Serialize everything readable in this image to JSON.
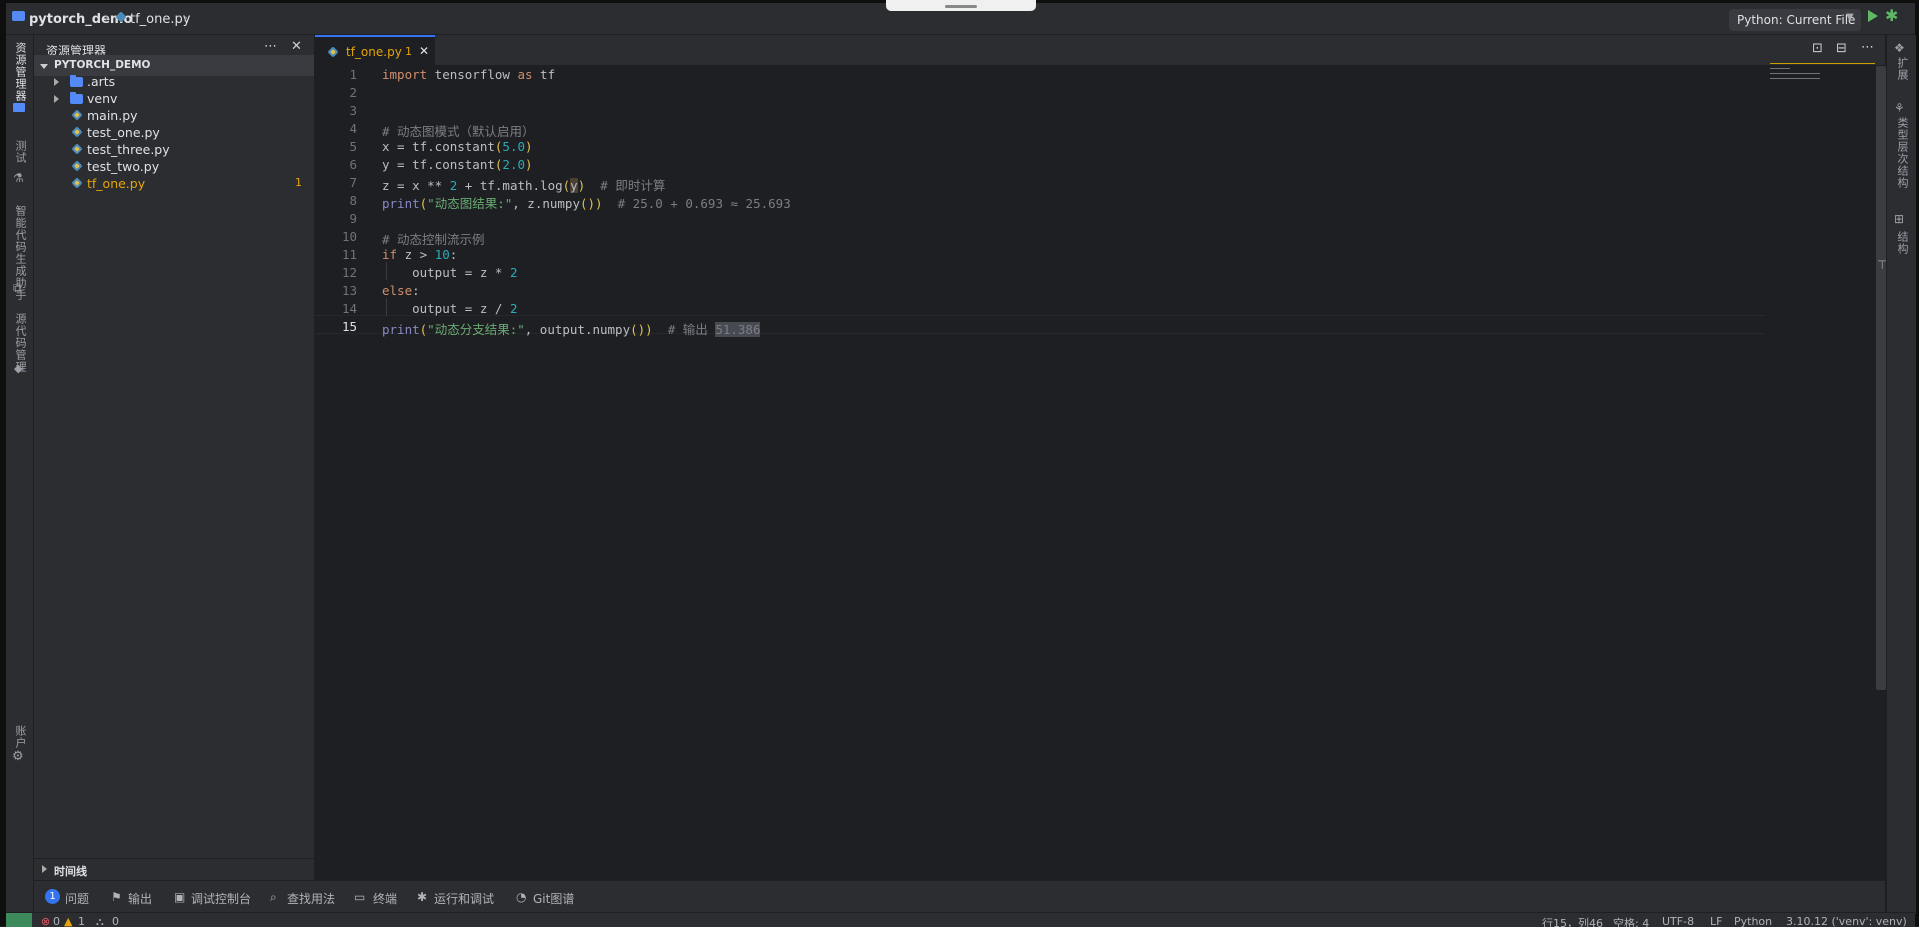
{
  "titlebar": {
    "project": "pytorch_demo",
    "file": "tf_one.py",
    "run_config": "Python: Current File"
  },
  "activity_bar": {
    "explorer": "资源管理器",
    "test": "测试",
    "code_helper": "智能代码生成助手",
    "source_control": "源代码管理",
    "account": "账户"
  },
  "sidebar": {
    "title": "资源管理器",
    "project_root": "PYTORCH_DEMO",
    "items": [
      {
        "label": ".arts",
        "kind": "folder"
      },
      {
        "label": "venv",
        "kind": "folder"
      },
      {
        "label": "main.py",
        "kind": "python"
      },
      {
        "label": "test_one.py",
        "kind": "python"
      },
      {
        "label": "test_three.py",
        "kind": "python"
      },
      {
        "label": "test_two.py",
        "kind": "python"
      },
      {
        "label": "tf_one.py",
        "kind": "python",
        "badge": "1"
      }
    ],
    "timeline": "时间线"
  },
  "editor": {
    "tab_label": "tf_one.py",
    "tab_badge": "1",
    "line_numbers": [
      "1",
      "2",
      "3",
      "4",
      "5",
      "6",
      "7",
      "8",
      "9",
      "10",
      "11",
      "12",
      "13",
      "14",
      "15"
    ],
    "current_line": 15
  },
  "right_bar": {
    "extensions": "扩展",
    "type_hierarchy": "类型层次结构",
    "structure": "结构"
  },
  "panel_tabs": {
    "problems_count": "1",
    "problems": "问题",
    "output": "输出",
    "debug_console": "调试控制台",
    "find_usages": "查找用法",
    "terminal": "终端",
    "run_debug": "运行和调试",
    "git_graph": "Git图谱"
  },
  "status_bar": {
    "errors": "0",
    "warnings": "1",
    "ports": "0",
    "position": "行15，列46",
    "indent": "空格: 4",
    "encoding": "UTF-8",
    "eol": "LF",
    "language": "Python",
    "interpreter": "3.10.12 ('venv': venv)"
  },
  "colors": {
    "keyword": "#cf8e6d",
    "number": "#2aacb8",
    "string": "#6aab73",
    "comment": "#7a7e85",
    "modified_file": "#e5a50a",
    "accent": "#3574f0"
  }
}
